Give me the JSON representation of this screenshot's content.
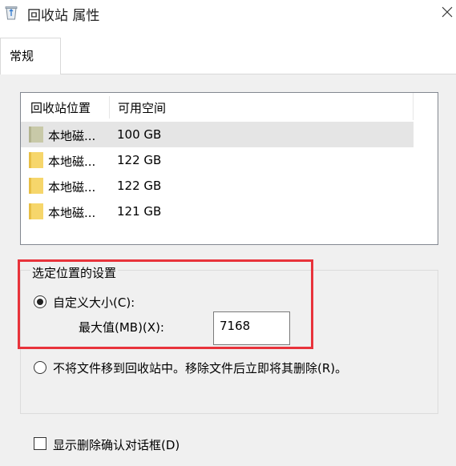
{
  "window": {
    "title": "回收站 属性"
  },
  "tabs": [
    {
      "label": "常规"
    }
  ],
  "listview": {
    "columns": [
      "回收站位置",
      "可用空间"
    ],
    "rows": [
      {
        "name": "本地磁...",
        "space": "100 GB",
        "selected": true
      },
      {
        "name": "本地磁...",
        "space": "122 GB"
      },
      {
        "name": "本地磁...",
        "space": "122 GB"
      },
      {
        "name": "本地磁...",
        "space": "121 GB"
      }
    ]
  },
  "settings": {
    "group_title": "选定位置的设置",
    "custom_size_label": "自定义大小(C):",
    "max_size_label": "最大值(MB)(X):",
    "max_size_value": "7168",
    "no_move_label": "不将文件移到回收站中。移除文件后立即将其删除(R)。",
    "selected_option": "custom_size"
  },
  "confirm_dialog_label": "显示删除确认对话框(D)",
  "colors": {
    "highlight_box": "#e8333b",
    "panel_bg": "#f0f0f0",
    "selected_row": "#e5e5e5",
    "folder_yellow": "#f6d66b",
    "folder_gray": "#c8c9a8"
  }
}
